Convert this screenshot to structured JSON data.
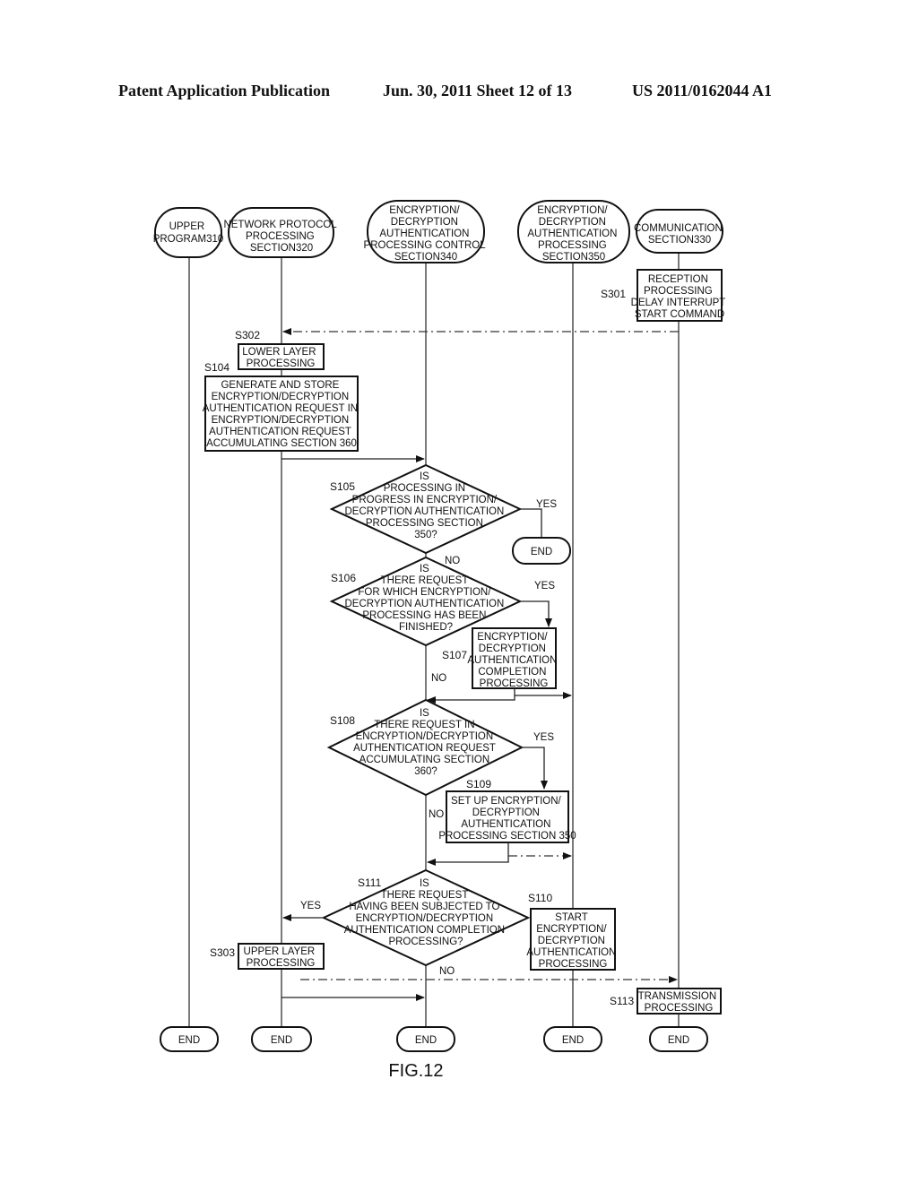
{
  "header": {
    "publication": "Patent Application Publication",
    "date_sheet": "Jun. 30, 2011  Sheet 12 of 13",
    "number": "US 2011/0162044 A1"
  },
  "lanes": [
    {
      "id": "upper",
      "lines": [
        "UPPER",
        "PROGRAM310"
      ]
    },
    {
      "id": "netproto",
      "lines": [
        "NETWORK PROTOCOL",
        "PROCESSING",
        "SECTION320"
      ]
    },
    {
      "id": "control",
      "lines": [
        "ENCRYPTION/",
        "DECRYPTION",
        "AUTHENTICATION",
        "PROCESSING CONTROL",
        "SECTION340"
      ]
    },
    {
      "id": "encsec",
      "lines": [
        "ENCRYPTION/",
        "DECRYPTION",
        "AUTHENTICATION",
        "PROCESSING",
        "SECTION350"
      ]
    },
    {
      "id": "comm",
      "lines": [
        "COMMUNICATION",
        "SECTION330"
      ]
    }
  ],
  "steps": {
    "s301": {
      "label": "S301",
      "lines": [
        "RECEPTION",
        "PROCESSING",
        "DELAY INTERRUPT",
        "START COMMAND"
      ]
    },
    "s302": {
      "label": "S302",
      "lines": [
        "LOWER LAYER",
        "PROCESSING"
      ]
    },
    "s104": {
      "label": "S104",
      "lines": [
        "GENERATE AND STORE",
        "ENCRYPTION/DECRYPTION",
        "AUTHENTICATION REQUEST IN",
        "ENCRYPTION/DECRYPTION",
        "AUTHENTICATION REQUEST",
        "ACCUMULATING SECTION 360"
      ]
    },
    "s105": {
      "label": "S105",
      "lines": [
        "IS",
        "PROCESSING IN",
        "PROGRESS IN ENCRYPTION/",
        "DECRYPTION AUTHENTICATION",
        "PROCESSING SECTION",
        "350?"
      ]
    },
    "s106": {
      "label": "S106",
      "lines": [
        "IS",
        "THERE REQUEST",
        "FOR WHICH ENCRYPTION/",
        "DECRYPTION AUTHENTICATION",
        "PROCESSING HAS BEEN",
        "FINISHED?"
      ]
    },
    "s107": {
      "label": "S107",
      "lines": [
        "ENCRYPTION/",
        "DECRYPTION",
        "AUTHENTICATION",
        "COMPLETION",
        "PROCESSING"
      ]
    },
    "s108": {
      "label": "S108",
      "lines": [
        "IS",
        "THERE REQUEST IN",
        "ENCRYPTION/DECRYPTION",
        "AUTHENTICATION REQUEST",
        "ACCUMULATING SECTION",
        "360?"
      ]
    },
    "s109": {
      "label": "S109",
      "lines": [
        "SET UP ENCRYPTION/",
        "DECRYPTION",
        "AUTHENTICATION",
        "PROCESSING SECTION 350"
      ]
    },
    "s110": {
      "label": "S110",
      "lines": [
        "START",
        "ENCRYPTION/",
        "DECRYPTION",
        "AUTHENTICATION",
        "PROCESSING"
      ]
    },
    "s111": {
      "label": "S111",
      "lines": [
        "IS",
        "THERE REQUEST",
        "HAVING BEEN SUBJECTED TO",
        "ENCRYPTION/DECRYPTION",
        "AUTHENTICATION COMPLETION",
        "PROCESSING?"
      ]
    },
    "s303": {
      "label": "S303",
      "lines": [
        "UPPER LAYER",
        "PROCESSING"
      ]
    },
    "s113": {
      "label": "S113",
      "lines": [
        "TRANSMISSION",
        "PROCESSING"
      ]
    }
  },
  "branch": {
    "yes": "YES",
    "no": "NO"
  },
  "end_label": "END",
  "figure_caption": "FIG.12"
}
